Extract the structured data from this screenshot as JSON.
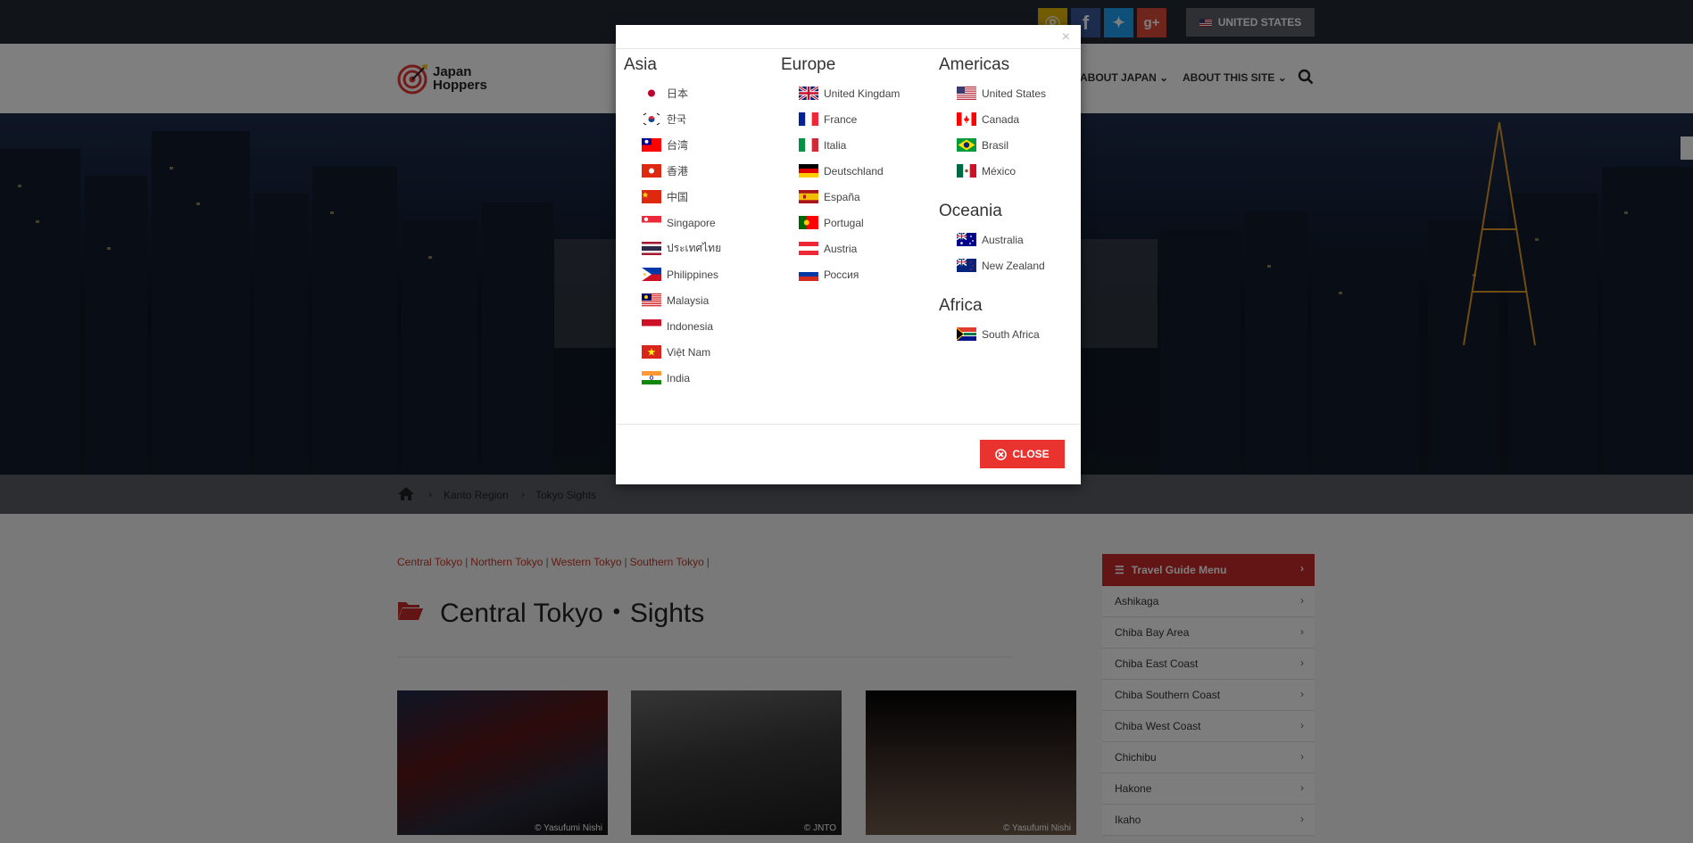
{
  "topbar": {
    "social": [
      {
        "name": "poi-icon",
        "glyph": "Ⓟ"
      },
      {
        "name": "facebook-icon",
        "glyph": "f"
      },
      {
        "name": "twitter-icon",
        "glyph": "✦"
      },
      {
        "name": "google-plus-icon",
        "glyph": "g+"
      }
    ],
    "country_label": "UNITED STATES"
  },
  "header": {
    "logo_line1": "Japan",
    "logo_line2": "Hoppers",
    "nav": [
      "ABOUT JAPAN",
      "ABOUT THIS SITE"
    ]
  },
  "breadcrumb": [
    "Kanto Region",
    "Tokyo Sights"
  ],
  "content": {
    "sublinks": [
      "Central Tokyo",
      "Northern Tokyo",
      "Western Tokyo",
      "Southern Tokyo"
    ],
    "title": "Central Tokyo・Sights",
    "thumbs": [
      {
        "credit": "© Yasufumi Nishi"
      },
      {
        "credit": "© JNTO"
      },
      {
        "credit": "© Yasufumi Nishi"
      }
    ]
  },
  "side_menu": {
    "title": "Travel Guide Menu",
    "items": [
      "Ashikaga",
      "Chiba Bay Area",
      "Chiba East Coast",
      "Chiba Southern Coast",
      "Chiba West Coast",
      "Chichibu",
      "Hakone",
      "Ikaho"
    ]
  },
  "modal": {
    "regions": [
      {
        "title": "Asia",
        "countries": [
          {
            "label": "日本",
            "flag": "jp"
          },
          {
            "label": "한국",
            "flag": "kr"
          },
          {
            "label": "台湾",
            "flag": "tw"
          },
          {
            "label": "香港",
            "flag": "hk"
          },
          {
            "label": "中国",
            "flag": "cn"
          },
          {
            "label": "Singapore",
            "flag": "sg"
          },
          {
            "label": "ประเทศไทย",
            "flag": "th"
          },
          {
            "label": "Philippines",
            "flag": "ph"
          },
          {
            "label": "Malaysia",
            "flag": "my"
          },
          {
            "label": "Indonesia",
            "flag": "id"
          },
          {
            "label": "Việt Nam",
            "flag": "vn"
          },
          {
            "label": "India",
            "flag": "in"
          }
        ]
      },
      {
        "title": "Europe",
        "countries": [
          {
            "label": "United Kingdam",
            "flag": "gb"
          },
          {
            "label": "France",
            "flag": "fr"
          },
          {
            "label": "Italia",
            "flag": "it"
          },
          {
            "label": "Deutschland",
            "flag": "de"
          },
          {
            "label": "España",
            "flag": "es"
          },
          {
            "label": "Portugal",
            "flag": "pt"
          },
          {
            "label": "Austria",
            "flag": "at"
          },
          {
            "label": "Россия",
            "flag": "ru"
          }
        ]
      },
      {
        "title": "Americas",
        "countries": [
          {
            "label": "United States",
            "flag": "us"
          },
          {
            "label": "Canada",
            "flag": "ca"
          },
          {
            "label": "Brasil",
            "flag": "br"
          },
          {
            "label": "México",
            "flag": "mx"
          }
        ]
      },
      {
        "title": "Oceania",
        "countries": [
          {
            "label": "Australia",
            "flag": "au"
          },
          {
            "label": "New Zealand",
            "flag": "nz"
          }
        ]
      },
      {
        "title": "Africa",
        "countries": [
          {
            "label": "South Africa",
            "flag": "za"
          }
        ]
      }
    ],
    "close_x": "×",
    "close_label": "CLOSE"
  },
  "colors": {
    "accent": "#e8332e",
    "menu_red": "#c62828",
    "topbar": "#222a35"
  }
}
